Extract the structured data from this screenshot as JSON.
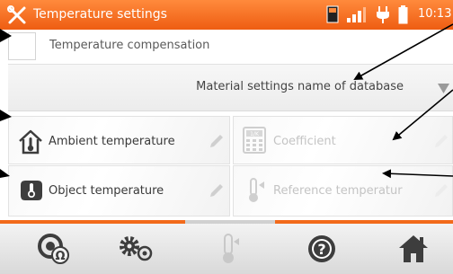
{
  "statusbar": {
    "title": "Temperature settings",
    "time": "10:13",
    "icons": [
      "tools-icon",
      "memory-card-icon",
      "signal-icon",
      "plug-icon",
      "battery-icon"
    ]
  },
  "compensation": {
    "label": "Temperature compensation",
    "checked": false
  },
  "material_dropdown": {
    "value": "Material settings name of database",
    "icon": "triangle-down-icon"
  },
  "tiles": {
    "ambient": {
      "label": "Ambient temperature",
      "icon": "house-thermometer-icon",
      "enabled": true
    },
    "coefficient": {
      "label": "Coefficient",
      "icon": "coefficient-calculator-icon",
      "enabled": false
    },
    "object": {
      "label": "Object temperature",
      "icon": "object-thermometer-icon",
      "enabled": true
    },
    "reference": {
      "label": "Reference temperatur",
      "icon": "thermometer-icon",
      "enabled": false
    }
  },
  "toolbar": {
    "buttons": [
      {
        "name": "resistance-mode-icon",
        "enabled": true
      },
      {
        "name": "settings-gears-icon",
        "enabled": true
      },
      {
        "name": "thermometer-icon",
        "enabled": false
      },
      {
        "name": "help-icon",
        "enabled": true
      },
      {
        "name": "home-icon",
        "enabled": true
      }
    ]
  },
  "colors": {
    "accent": "#f26a1b",
    "status_bar": "#ee5d12",
    "icon_dark": "#3d3d3d",
    "disabled": "#c8c8c8",
    "arrow": "#000000"
  }
}
